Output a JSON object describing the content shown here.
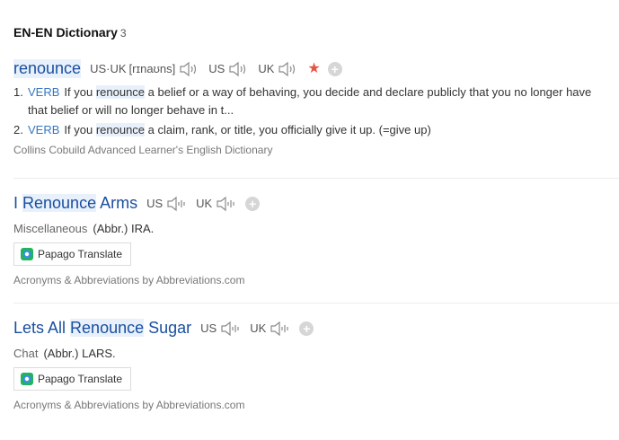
{
  "header": {
    "title": "EN-EN Dictionary",
    "count": "3"
  },
  "entries": [
    {
      "headword": "renounce",
      "pron_label": "US·UK",
      "pron": "[rɪnaʊns]",
      "us_label": "US",
      "uk_label": "UK",
      "definitions": [
        {
          "num": "1.",
          "pos": "VERB",
          "pre": "If you ",
          "hl": "renounce",
          "post": " a belief or a way of behaving, you decide and declare publicly that you no longer have that belief or will no longer behave in t..."
        },
        {
          "num": "2.",
          "pos": "VERB",
          "pre": "If you ",
          "hl": "renounce",
          "post": " a claim, rank, or title, you officially give it up. (=give up)"
        }
      ],
      "source": "Collins Cobuild Advanced Learner's English Dictionary"
    },
    {
      "headword_pre": "I ",
      "headword_hl": "Renounce",
      "headword_post": " Arms",
      "us_label": "US",
      "uk_label": "UK",
      "category": "Miscellaneous",
      "meaning": "(Abbr.) IRA.",
      "papago": "Papago Translate",
      "source": "Acronyms & Abbreviations by Abbreviations.com"
    },
    {
      "headword_pre": "Lets All ",
      "headword_hl": "Renounce",
      "headword_post": " Sugar",
      "us_label": "US",
      "uk_label": "UK",
      "category": "Chat",
      "meaning": "(Abbr.) LARS.",
      "papago": "Papago Translate",
      "source": "Acronyms & Abbreviations by Abbreviations.com"
    }
  ],
  "colors": {
    "headword": "#1a4fa0",
    "pos": "#3576c3",
    "star": "#e45546",
    "highlight": "#e8f1fb"
  }
}
